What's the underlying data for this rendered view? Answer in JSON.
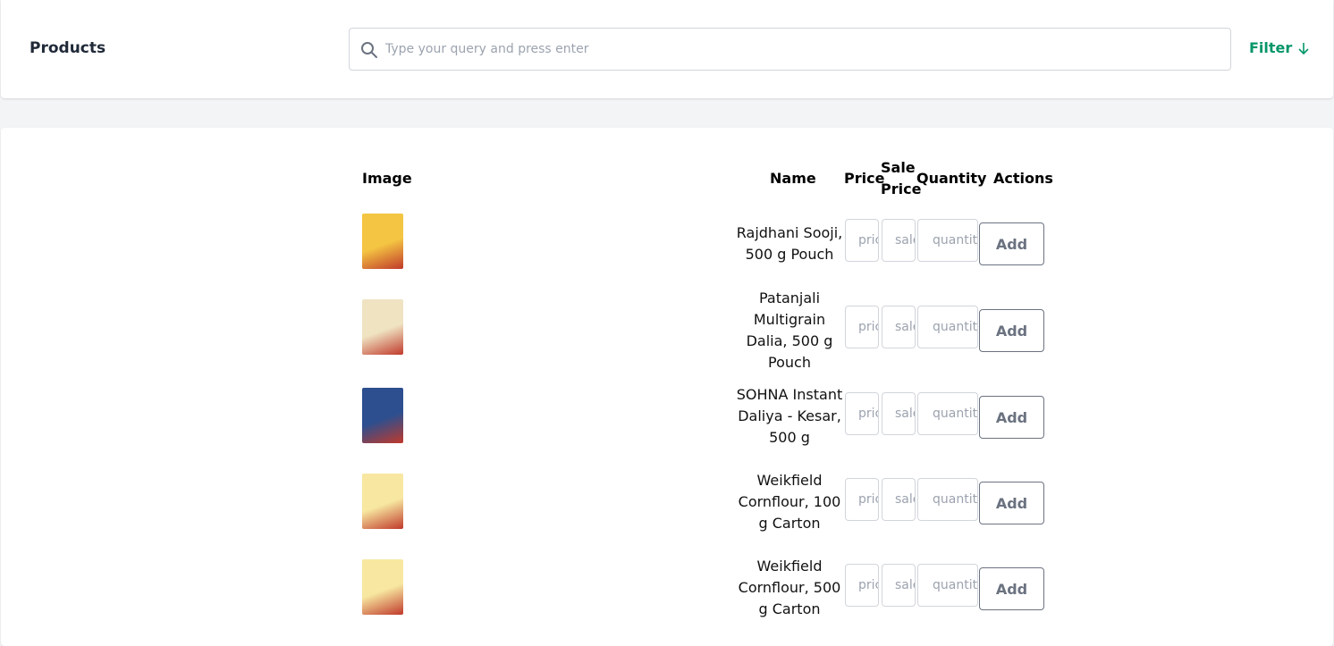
{
  "header": {
    "title": "Products",
    "search_placeholder": "Type your query and press enter",
    "filter_label": "Filter"
  },
  "table": {
    "columns": {
      "image": "Image",
      "name": "Name",
      "price": "Price",
      "sale_price": "Sale Price",
      "quantity": "Quantity",
      "actions": "Actions"
    },
    "input_placeholders": {
      "price": "price",
      "sale_price": "sale price",
      "quantity": "quantity"
    },
    "add_label": "Add",
    "rows": [
      {
        "name": "Rajdhani Sooji, 500 g Pouch",
        "thumb_color": "#f4c542"
      },
      {
        "name": "Patanjali Multigrain Dalia, 500 g Pouch",
        "thumb_color": "#efe3c2"
      },
      {
        "name": "SOHNA Instant Daliya - Kesar, 500 g",
        "thumb_color": "#2d4f8f"
      },
      {
        "name": "Weikfield Cornflour, 100 g Carton",
        "thumb_color": "#f7e7a0"
      },
      {
        "name": "Weikfield Cornflour, 500 g Carton",
        "thumb_color": "#f7e7a0"
      }
    ]
  },
  "colors": {
    "accent": "#059669",
    "border": "#d1d5db",
    "background": "#f3f4f6"
  }
}
